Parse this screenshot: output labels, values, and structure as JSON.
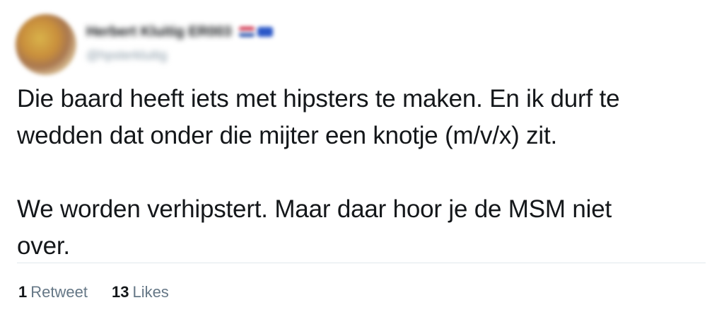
{
  "tweet": {
    "author": {
      "display_name": "Herbert Kluitig ER003",
      "handle": "@hpsterkluitig"
    },
    "text": {
      "paragraph1_line1": "Die baard heeft iets met hipsters te maken. En ik durf te",
      "paragraph1_line2": "wedden dat onder die mijter een knotje (m/v/x) zit.",
      "paragraph2_line1": "We worden verhipstert. Maar daar hoor je de MSM niet",
      "paragraph2_line2": "over."
    },
    "stats": {
      "retweets_count": "1",
      "retweets_label": "Retweet",
      "likes_count": "13",
      "likes_label": "Likes"
    }
  }
}
